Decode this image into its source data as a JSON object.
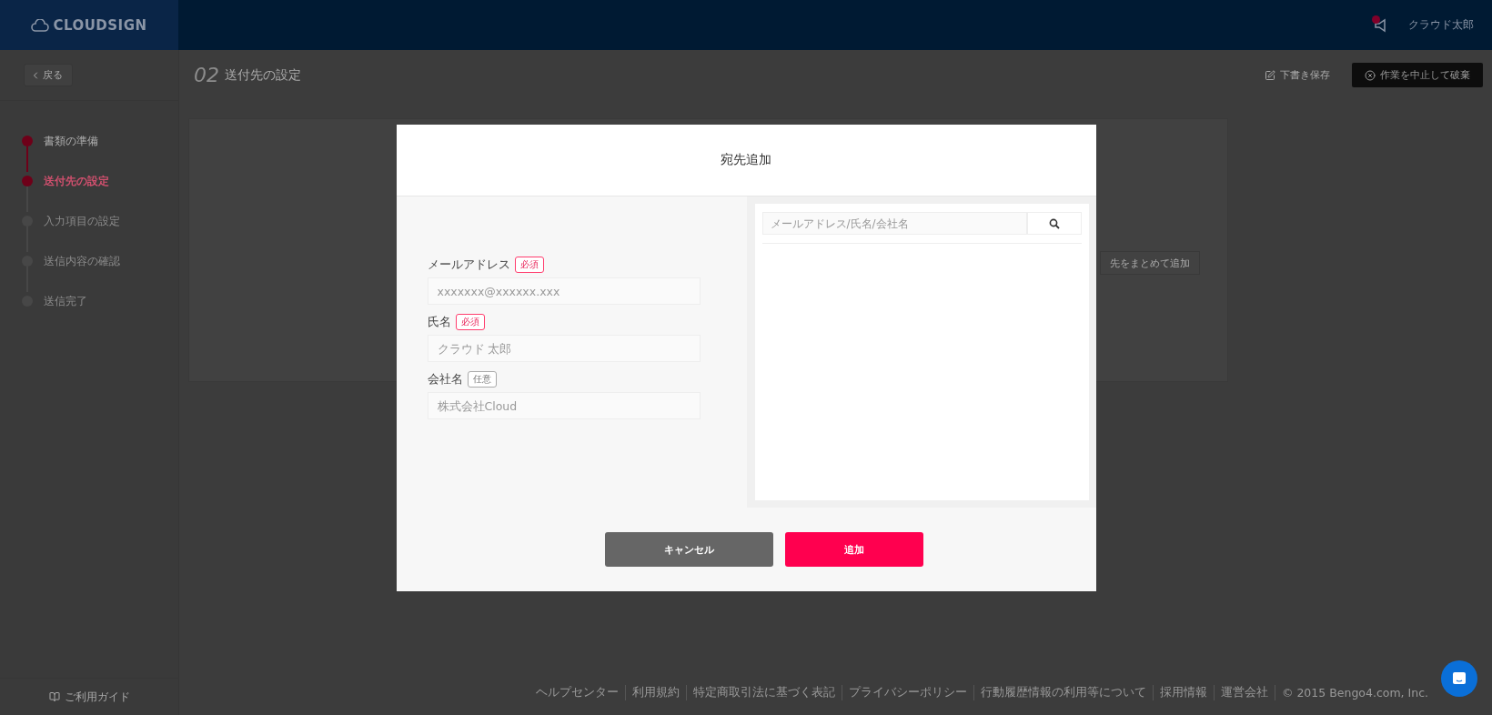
{
  "header": {
    "logo": "CLOUDSIGN",
    "user_name": "クラウド太郎",
    "has_notification": true
  },
  "toolbar": {
    "back": "戻る",
    "step_number": "02",
    "step_title": "送付先の設定",
    "save_draft": "下書き保存",
    "discard": "作業を中止して破棄"
  },
  "steps": [
    {
      "label": "書類の準備",
      "done": true,
      "selected": false
    },
    {
      "label": "送付先の設定",
      "done": true,
      "selected": true
    },
    {
      "label": "入力項目の設定",
      "done": false,
      "selected": false
    },
    {
      "label": "送信内容の確認",
      "done": false,
      "selected": false
    },
    {
      "label": "送信完了",
      "done": false,
      "selected": false
    }
  ],
  "sidebar_footer": "ご利用ガイド",
  "background_button": "先をまとめて追加",
  "footer_links": [
    "ヘルプセンター",
    "利用規約",
    "特定商取引法に基づく表記",
    "プライバシーポリシー",
    "行動履歴情報の利用等について",
    "採用情報",
    "運営会社"
  ],
  "copyright": "© 2015 Bengo4.com, Inc.",
  "dialog": {
    "title": "宛先追加",
    "fields": [
      {
        "label": "メールアドレス",
        "badge": "必須",
        "required": true,
        "placeholder": "xxxxxxx@xxxxxx.xxx"
      },
      {
        "label": "氏名",
        "badge": "必須",
        "required": true,
        "placeholder": "クラウド 太郎"
      },
      {
        "label": "会社名",
        "badge": "任意",
        "required": false,
        "placeholder": "株式会社Cloud"
      }
    ],
    "search": {
      "placeholder": "メールアドレス/氏名/会社名"
    },
    "buttons": [
      {
        "label": "キャンセル",
        "kind": "secondary"
      },
      {
        "label": "追加",
        "kind": "primary"
      }
    ]
  }
}
